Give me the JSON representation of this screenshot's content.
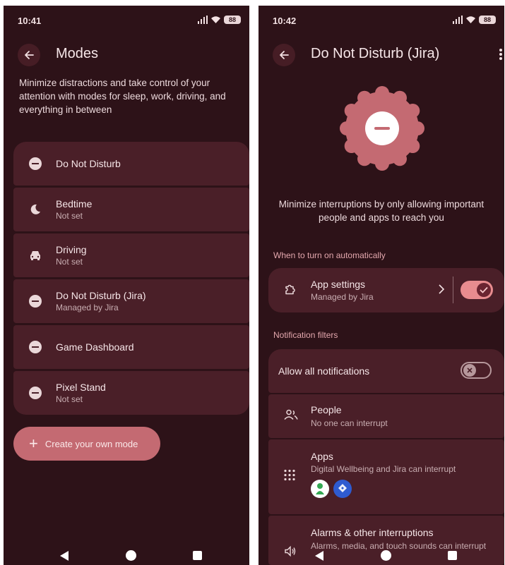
{
  "left": {
    "status": {
      "time": "10:41",
      "battery": "88"
    },
    "title": "Modes",
    "description": "Minimize distractions and take control of your attention with modes for sleep, work, driving, and everything in between",
    "modes": [
      {
        "title": "Do Not Disturb",
        "subtitle": "",
        "icon": "dnd-icon"
      },
      {
        "title": "Bedtime",
        "subtitle": "Not set",
        "icon": "moon-icon"
      },
      {
        "title": "Driving",
        "subtitle": "Not set",
        "icon": "car-icon"
      },
      {
        "title": "Do Not Disturb (Jira)",
        "subtitle": "Managed by Jira",
        "icon": "dnd-icon"
      },
      {
        "title": "Game Dashboard",
        "subtitle": "",
        "icon": "dnd-icon"
      },
      {
        "title": "Pixel Stand",
        "subtitle": "Not set",
        "icon": "dnd-icon"
      }
    ],
    "create_label": "Create your own mode"
  },
  "right": {
    "status": {
      "time": "10:42",
      "battery": "88"
    },
    "title": "Do Not Disturb (Jira)",
    "description": "Minimize interruptions by only allowing important people and apps to reach you",
    "section_auto": "When to turn on automatically",
    "app_settings": {
      "title": "App settings",
      "subtitle": "Managed by Jira",
      "enabled": true
    },
    "section_filters": "Notification filters",
    "allow_all": {
      "title": "Allow all notifications",
      "enabled": false
    },
    "people": {
      "title": "People",
      "subtitle": "No one can interrupt"
    },
    "apps": {
      "title": "Apps",
      "subtitle": "Digital Wellbeing and Jira can interrupt"
    },
    "alarms": {
      "title": "Alarms & other interruptions",
      "subtitle": "Alarms, media, and touch sounds can interrupt"
    }
  },
  "colors": {
    "background": "#2d1218",
    "card": "#4a1f28",
    "accent": "#c46a72",
    "accent_light": "#e88c8f"
  }
}
